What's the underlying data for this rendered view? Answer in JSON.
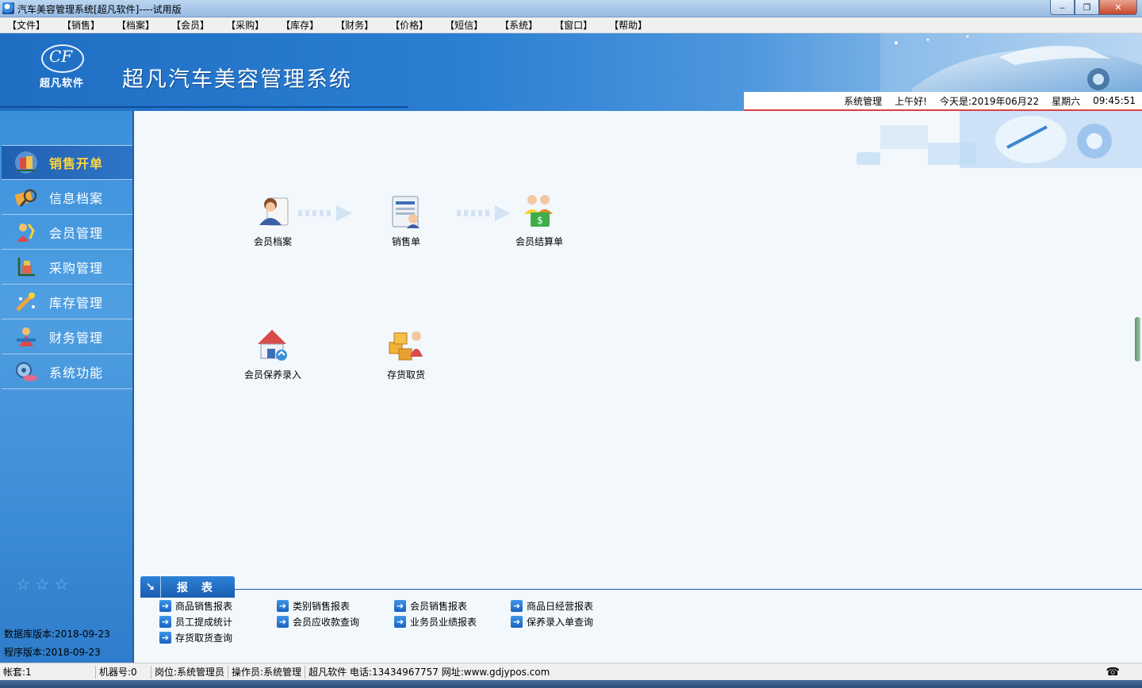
{
  "window": {
    "title": "汽车美容管理系统[超凡软件]----试用版",
    "buttons": {
      "minimize": "‒",
      "maximize": "❐",
      "close": "✕"
    }
  },
  "menu": [
    "【文件】",
    "【销售】",
    "【档案】",
    "【会员】",
    "【采购】",
    "【库存】",
    "【财务】",
    "【价格】",
    "【短信】",
    "【系统】",
    "【窗口】",
    "【帮助】"
  ],
  "banner": {
    "logo_mark": "CF",
    "logo_text": "超凡软件",
    "system_title": "超凡汽车美容管理系统"
  },
  "info": {
    "user": "系统管理",
    "greeting": "上午好!",
    "date": "今天是:2019年06月22",
    "weekday": "星期六",
    "time": "09:45:51"
  },
  "sidebar": {
    "items": [
      {
        "label": "销售开单",
        "icon": "sales-order-icon",
        "active": true
      },
      {
        "label": "信息档案",
        "icon": "info-archive-icon",
        "active": false
      },
      {
        "label": "会员管理",
        "icon": "member-manage-icon",
        "active": false
      },
      {
        "label": "采购管理",
        "icon": "purchase-manage-icon",
        "active": false
      },
      {
        "label": "库存管理",
        "icon": "inventory-manage-icon",
        "active": false
      },
      {
        "label": "财务管理",
        "icon": "finance-manage-icon",
        "active": false
      },
      {
        "label": "系统功能",
        "icon": "system-function-icon",
        "active": false
      }
    ],
    "db_version": "数据库版本:2018-09-23",
    "app_version": "程序版本:2018-09-23"
  },
  "flow": {
    "member_archive": "会员档案",
    "sales_order": "销售单",
    "member_settlement": "会员结算单",
    "maintenance_entry": "会员保养录入",
    "stock_pickup": "存货取货"
  },
  "reports": {
    "header": "报 表",
    "links": [
      "商品销售报表",
      "类别销售报表",
      "会员销售报表",
      "商品日经营报表",
      "员工提成统计",
      "会员应收款查询",
      "业务员业绩报表",
      "保养录入单查询",
      "存货取货查询"
    ]
  },
  "status": {
    "account": "帐套:1",
    "machine": "机器号:0",
    "post": "岗位:系统管理员",
    "operator": "操作员:系统管理",
    "company": "超凡软件 电话:13434967757 网址:www.gdjypos.com"
  },
  "colors": {
    "sidebar": "#3a8fdb",
    "active_label": "#ffd43a",
    "banner": "#2b7ed2",
    "main_bg": "#f3f8fd"
  }
}
